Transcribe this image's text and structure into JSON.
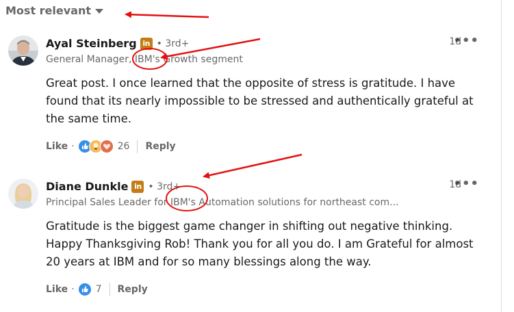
{
  "sort": {
    "label": "Most relevant"
  },
  "comments": [
    {
      "author": "Ayal Steinberg",
      "degree": "• 3rd+",
      "headline": "General Manager, IBM's Growth segment",
      "time": "1d",
      "more": "•••",
      "text": "Great post. I once learned that the opposite of stress is gratitude. I have found that its nearly impossible to be stressed and authentically grateful at the same time.",
      "like_label": "Like",
      "reaction_count": "26",
      "reactions": [
        "like-icon",
        "insightful-icon",
        "support-icon"
      ],
      "reply_label": "Reply"
    },
    {
      "author": "Diane Dunkle",
      "degree": "• 3rd+",
      "headline": "Principal Sales Leader for IBM's Automation solutions for northeast com...",
      "time": "1d",
      "more": "•••",
      "text": "Gratitude is the biggest game changer in shifting out negative thinking. Happy Thanksgiving Rob! Thank you for all you do. I am Grateful for almost 20 years at IBM and for so many blessings along the way.",
      "like_label": "Like",
      "reaction_count": "7",
      "reactions": [
        "like-icon"
      ],
      "reply_label": "Reply"
    }
  ],
  "badge": {
    "text": "in"
  },
  "colors": {
    "annotation": "#e3100f",
    "linkedin_badge": "#c37d16",
    "like": "#378fe9"
  }
}
